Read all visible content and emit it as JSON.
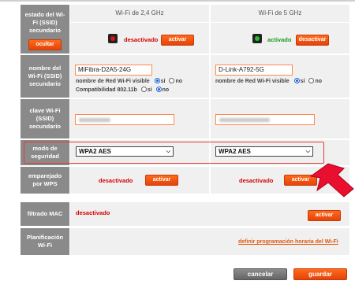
{
  "columns": {
    "band24": "Wi-Fi de 2,4 GHz",
    "band5": "Wi-Fi de 5 GHz"
  },
  "rows": {
    "ssid_state": {
      "label": "estado del Wi-Fi (SSID) secundario",
      "hide_button": "ocultar",
      "band24": {
        "status": "desactivado",
        "button": "activar",
        "led_color": "#e01010"
      },
      "band5": {
        "status": "activado",
        "button": "desactivar",
        "led_color": "#22c022"
      }
    },
    "ssid_name": {
      "label": "nombre del Wi-Fi (SSID) secundario",
      "band24": {
        "value": "MiFibra-D2A5-24G",
        "visible_label": "nombre de Red Wi-Fi visible",
        "yes": "sí",
        "no": "no",
        "compat_label": "Compatibilidad 802.11b",
        "compat_yes": "sí",
        "compat_no": "no"
      },
      "band5": {
        "value": "D-Link-A792-5G",
        "visible_label": "nombre de Red Wi-Fi visible",
        "yes": "sí",
        "no": "no"
      }
    },
    "ssid_key": {
      "label": "clave Wi-Fi (SSID) secundario"
    },
    "security": {
      "label": "modo de seguridad",
      "band24": "WPA2 AES",
      "band5": "WPA2 AES"
    },
    "wps": {
      "label": "emparejado por WPS",
      "band24": {
        "status": "desactivado",
        "button": "activar"
      },
      "band5": {
        "status": "desactivado",
        "button": "activar"
      }
    },
    "mac": {
      "label": "filtrado MAC",
      "status": "desactivado",
      "button": "activar"
    },
    "schedule": {
      "label": "Planificación Wi-Fi",
      "link": "definir programación horaria del Wi-Fi"
    }
  },
  "footer": {
    "cancel": "cancelar",
    "save": "guardar"
  },
  "colors": {
    "accent": "#e5430a",
    "label_bg": "#8a8a8a",
    "highlight": "#e53a3a"
  }
}
